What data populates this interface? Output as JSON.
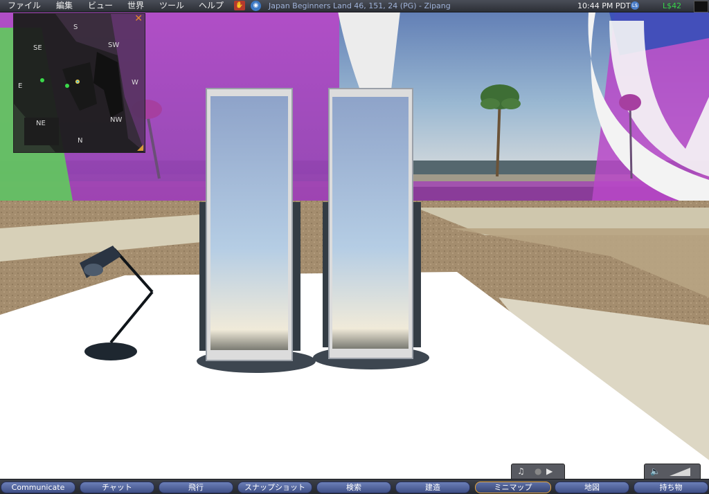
{
  "menu": {
    "items": [
      "ファイル",
      "編集",
      "ビュー",
      "世界",
      "ツール",
      "ヘルプ"
    ],
    "location": "Japan Beginners Land 46, 151, 24 (PG) - Zipang",
    "time": "10:44 PM PDT",
    "balance": "L$42"
  },
  "minimap": {
    "compass": {
      "s": "S",
      "sw": "SW",
      "se": "SE",
      "e": "E",
      "w": "W",
      "ne": "NE",
      "nw": "NW",
      "n": "N"
    },
    "close_symbol": "✕"
  },
  "toolbar": {
    "buttons": [
      "Communicate",
      "チャット",
      "飛行",
      "スナップショット",
      "検索",
      "建造",
      "ミニマップ",
      "地図",
      "持ち物"
    ],
    "active_button": "ミニマップ"
  },
  "icons": {
    "parcel": "no-push-icon",
    "voice": "voice-icon",
    "buy_currency": "linden-dollar-icon",
    "music": "music-icon",
    "media_stop": "stop-icon",
    "media_play": "play-icon",
    "volume": "speaker-icon",
    "volume_slider": "volume-slider-icon"
  },
  "colors": {
    "balance": "#37d44a",
    "location": "#9fb2d8",
    "active_button_border": "#e8a53a",
    "sky_top": "#5f7fb6",
    "magenta_wall": "#b53fc5"
  }
}
